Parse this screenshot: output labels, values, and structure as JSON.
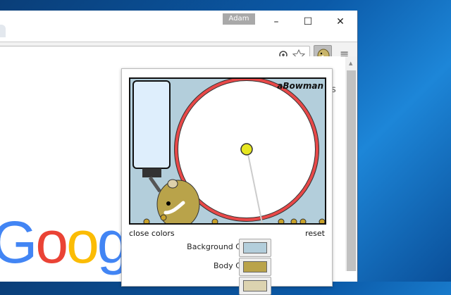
{
  "window": {
    "profile": "Adam",
    "minimize": "–",
    "maximize": "☐",
    "close": "✕"
  },
  "toolbar": {
    "zoom_icon": "zoom-in-icon",
    "star_icon": "star-icon",
    "menu": "≡"
  },
  "page": {
    "logo": [
      "G",
      "o",
      "o",
      "g"
    ],
    "side_text": "s"
  },
  "popup": {
    "credit": "aBowman",
    "close_colors": "close colors",
    "reset": "reset",
    "colors": [
      {
        "label": "Background Color",
        "value": "#b3cedb"
      },
      {
        "label": "Body Color",
        "value": "#b9a34a"
      },
      {
        "label": "",
        "value": "#dcd3b0"
      }
    ]
  }
}
